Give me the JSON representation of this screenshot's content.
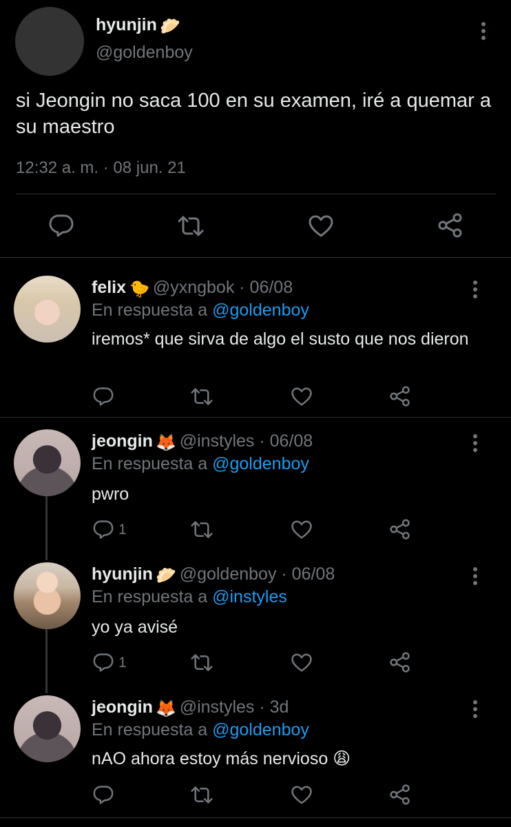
{
  "main_tweet": {
    "name": "hyunjin",
    "emoji": "🥟",
    "handle": "@goldenboy",
    "text": "si Jeongin no saca 100 en su examen, iré a quemar a su maestro",
    "timestamp": "12:32 a. m. · 08 jun. 21"
  },
  "replies": [
    {
      "name": "felix",
      "emoji": "🐤",
      "handle": "@yxngbok · 06/08",
      "reply_prefix": "En respuesta a ",
      "reply_to": "@goldenboy",
      "text": "iremos* que sirva de algo el susto que nos dieron",
      "reply_count": ""
    },
    {
      "name": "jeongin",
      "emoji": "🦊",
      "handle": "@instyles · 06/08",
      "reply_prefix": "En respuesta a ",
      "reply_to": "@goldenboy",
      "text": "pwro",
      "reply_count": "1"
    },
    {
      "name": "hyunjin",
      "emoji": "🥟",
      "handle": "@goldenboy · 06/08",
      "reply_prefix": "En respuesta a ",
      "reply_to": "@instyles",
      "text": "yo ya avisé",
      "reply_count": "1"
    },
    {
      "name": "jeongin",
      "emoji": "🦊",
      "handle": "@instyles · 3d",
      "reply_prefix": "En respuesta a ",
      "reply_to": "@goldenboy",
      "text": "nAO ahora estoy más nervioso 😩",
      "reply_count": ""
    }
  ],
  "icons": [
    "reply-icon",
    "retweet-icon",
    "like-icon",
    "share-icon",
    "more-icon"
  ],
  "colors": {
    "background": "#000000",
    "text": "#e7e9ea",
    "muted": "#71767b",
    "link": "#1d9bf0",
    "divider": "#2f3336"
  }
}
